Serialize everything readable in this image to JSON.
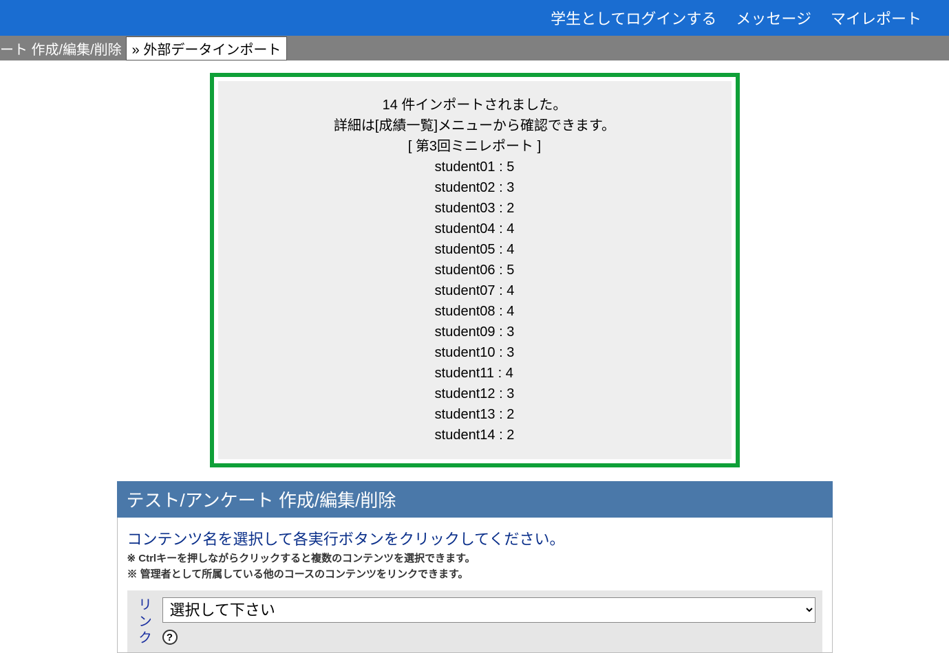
{
  "topnav": {
    "login_as_student": "学生としてログインする",
    "messages": "メッセージ",
    "my_report": "マイレポート"
  },
  "breadcrumb": {
    "prev": "ート 作成/編集/削除",
    "current": "» 外部データインポート"
  },
  "result": {
    "line1": "14 件インポートされました。",
    "line2": "詳細は[成績一覧]メニューから確認できます。",
    "line3": "[ 第3回ミニレポート ]",
    "students": [
      "student01 : 5",
      "student02 : 3",
      "student03 : 2",
      "student04 : 4",
      "student05 : 4",
      "student06 : 5",
      "student07 : 4",
      "student08 : 4",
      "student09 : 3",
      "student10 : 3",
      "student11 : 4",
      "student12 : 3",
      "student13 : 2",
      "student14 : 2"
    ]
  },
  "section": {
    "header": "テスト/アンケート 作成/編集/削除",
    "instruction": "コンテンツ名を選択して各実行ボタンをクリックしてください。",
    "hint1": "※ Ctrlキーを押しながらクリックすると複数のコンテンツを選択できます。",
    "hint2": "※ 管理者として所属している他のコースのコンテンツをリンクできます。",
    "link_label": "リンク",
    "select_placeholder": "選択して下さい",
    "help_glyph": "?"
  }
}
